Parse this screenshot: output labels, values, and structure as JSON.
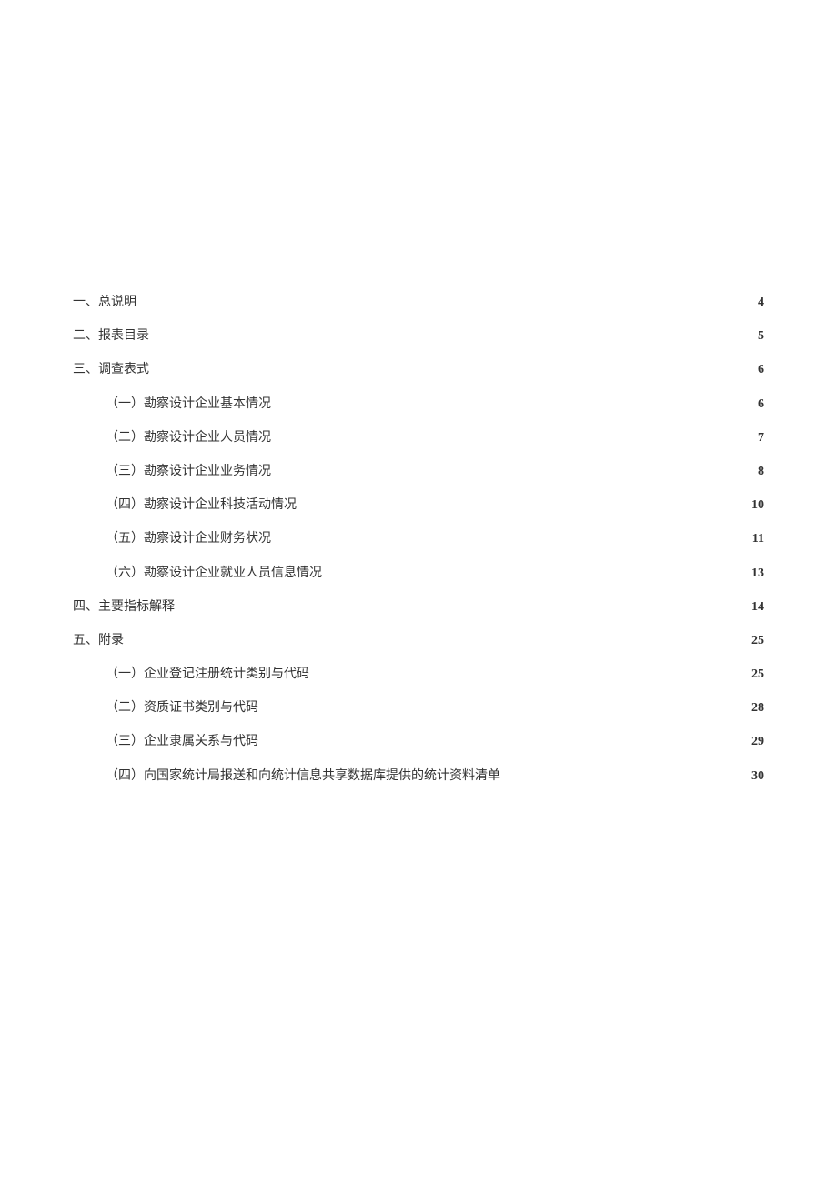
{
  "toc": [
    {
      "level": 1,
      "label": "一、总说明",
      "page": "4"
    },
    {
      "level": 1,
      "label": "二、报表目录",
      "page": "5"
    },
    {
      "level": 1,
      "label": "三、调查表式",
      "page": "6"
    },
    {
      "level": 2,
      "label": "（一）勘察设计企业基本情况",
      "page": "6"
    },
    {
      "level": 2,
      "label": "（二）勘察设计企业人员情况",
      "page": "7"
    },
    {
      "level": 2,
      "label": "（三）勘察设计企业业务情况",
      "page": "8"
    },
    {
      "level": 2,
      "label": "（四）勘察设计企业科技活动情况",
      "page": "10"
    },
    {
      "level": 2,
      "label": "（五）勘察设计企业财务状况",
      "page": "11"
    },
    {
      "level": 2,
      "label": "（六）勘察设计企业就业人员信息情况",
      "page": "13"
    },
    {
      "level": 1,
      "label": "四、主要指标解释",
      "page": "14"
    },
    {
      "level": 1,
      "label": "五、附录",
      "page": "25"
    },
    {
      "level": 2,
      "label": "（一）企业登记注册统计类别与代码",
      "page": "25"
    },
    {
      "level": 2,
      "label": "（二）资质证书类别与代码",
      "page": "28"
    },
    {
      "level": 2,
      "label": "（三）企业隶属关系与代码",
      "page": "29"
    },
    {
      "level": 2,
      "label": "（四）向国家统计局报送和向统计信息共享数据库提供的统计资料清单",
      "page": "30"
    }
  ]
}
